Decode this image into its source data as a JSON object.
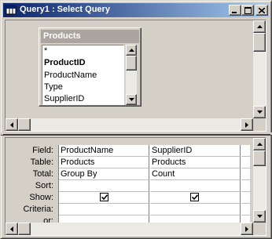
{
  "window": {
    "title": "Query1 : Select Query",
    "icon": "query-icon",
    "controls": [
      "minimize-icon",
      "maximize-icon",
      "close-icon"
    ]
  },
  "table_panel": {
    "title": "Products",
    "fields": [
      "*",
      "ProductID",
      "ProductName",
      "Type",
      "SupplierID"
    ],
    "primary_key_field": "ProductID"
  },
  "design_grid": {
    "row_labels": [
      "Field:",
      "Table:",
      "Total:",
      "Sort:",
      "Show:",
      "Criteria:",
      "or:"
    ],
    "columns": [
      {
        "field": "ProductName",
        "table": "Products",
        "total": "Group By",
        "sort": "",
        "show": true,
        "criteria": "",
        "or": ""
      },
      {
        "field": "SupplierID",
        "table": "Products",
        "total": "Count",
        "sort": "",
        "show": true,
        "criteria": "",
        "or": ""
      }
    ]
  },
  "colors": {
    "title_gradient_start": "#0a246a",
    "title_gradient_end": "#a6caf0",
    "inactive_panel_title": "#aaa69f",
    "face": "#d4d0c8"
  }
}
